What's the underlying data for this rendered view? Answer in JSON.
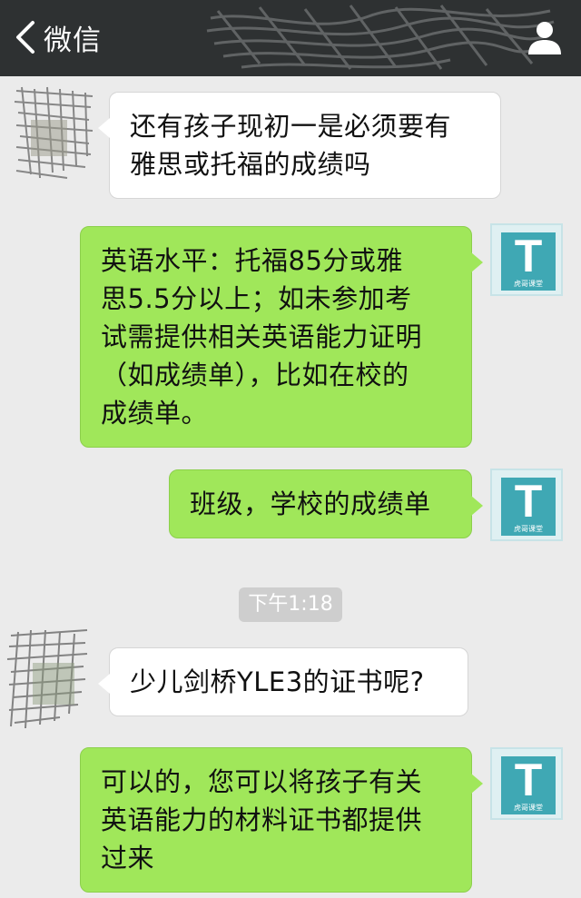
{
  "nav": {
    "back_label": "微信",
    "icons": {
      "back": "chevron-left-icon",
      "profile": "person-icon"
    },
    "colors": {
      "bar": "#2e3132",
      "text": "#ffffff"
    }
  },
  "chat": {
    "messages": [
      {
        "side": "left",
        "sender": "obscured-user",
        "text_lines": [
          "还有孩子现初一是必须要有",
          "雅思或托福的成绩吗"
        ]
      },
      {
        "side": "right",
        "sender": "T",
        "text_lines": [
          "英语水平：托福85分或雅",
          "思5.5分以上；如未参加考",
          "试需提供相关英语能力证明",
          "（如成绩单），比如在校的",
          "成绩单。"
        ]
      },
      {
        "side": "right",
        "sender": "T",
        "text_lines": [
          "班级，学校的成绩单"
        ]
      },
      {
        "side": "left",
        "sender": "obscured-user",
        "text_lines": [
          "少儿剑桥YLE3的证书呢?"
        ]
      },
      {
        "side": "right",
        "sender": "T",
        "text_lines": [
          "可以的，您可以将孩子有关",
          "英语能力的材料证书都提供",
          "过来"
        ]
      }
    ],
    "timestamp": "下午1:18",
    "avatar_t": {
      "letter": "T",
      "caption": "虎哥课堂"
    },
    "colors": {
      "background": "#ebebeb",
      "left_bubble": "#ffffff",
      "right_bubble": "#a0e75a",
      "avatar_teal": "#3fa8b4"
    }
  }
}
